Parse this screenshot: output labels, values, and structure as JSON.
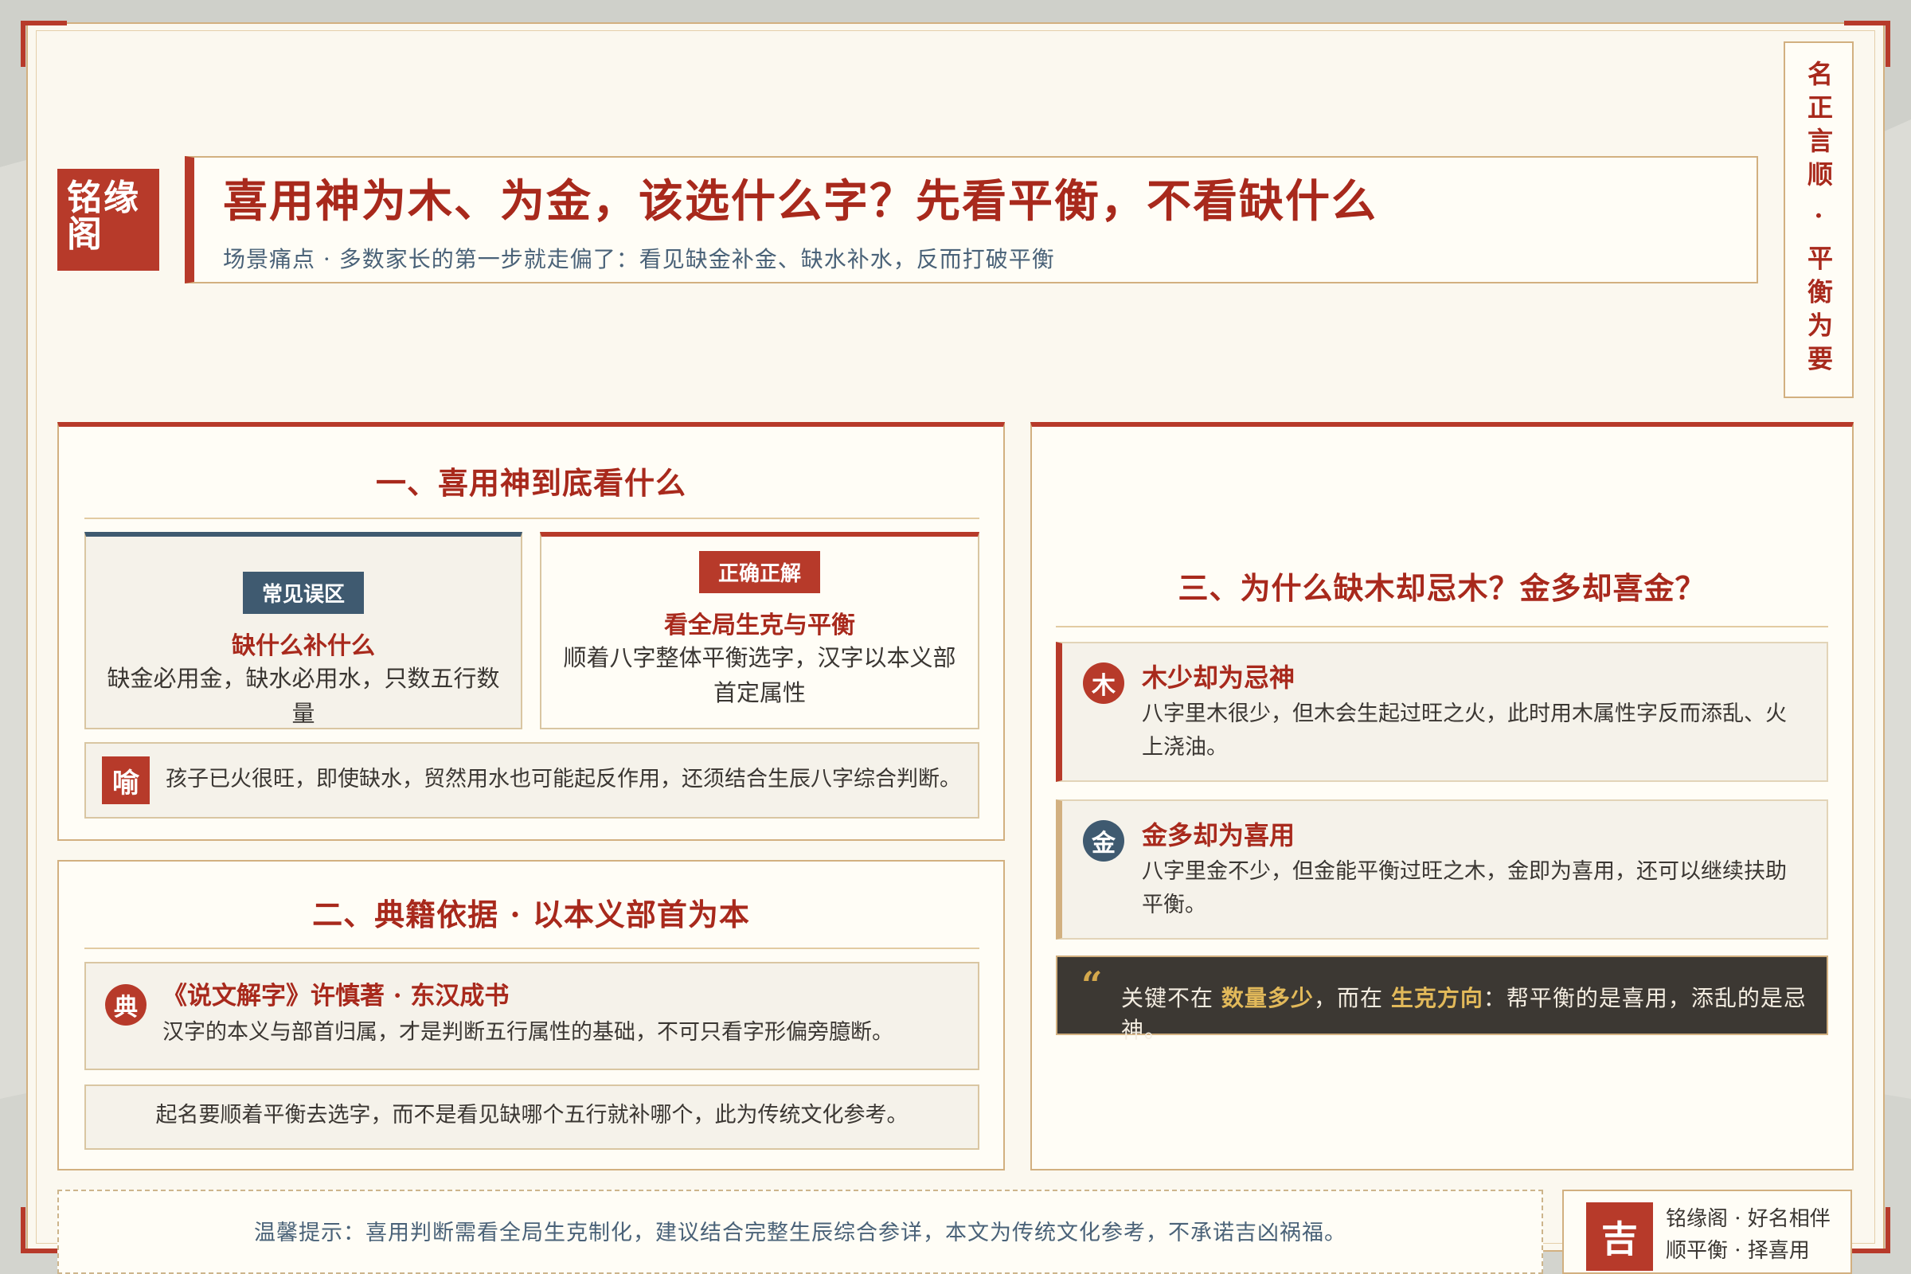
{
  "brand": {
    "logo_text": "铭缘阁"
  },
  "header": {
    "title": "喜用神为木、为金，该选什么字？先看平衡，不看缺什么",
    "subtitle": "场景痛点 · 多数家长的第一步就走偏了：看见缺金补金、缺水补水，反而打破平衡"
  },
  "side_motto": "名正言顺 · 平衡为要",
  "section1": {
    "heading": "一、喜用神到底看什么",
    "wrong": {
      "tag": "常见误区",
      "title": "缺什么补什么",
      "text": "缺金必用金，缺水必用水，只数五行数量"
    },
    "right": {
      "tag": "正确正解",
      "title": "看全局生克与平衡",
      "text": "顺着八字整体平衡选字，汉字以本义部首定属性"
    },
    "example": {
      "badge": "喻",
      "text": "孩子已火很旺，即使缺水，贸然用水也可能起反作用，还须结合生辰八字综合判断。"
    }
  },
  "section2": {
    "heading": "二、典籍依据 · 以本义部首为本",
    "classic": {
      "badge": "典",
      "title": "《说文解字》许慎著 · 东汉成书",
      "text": "汉字的本义与部首归属，才是判断五行属性的基础，不可只看字形偏旁臆断。"
    },
    "note": "起名要顺着平衡去选字，而不是看见缺哪个五行就补哪个，此为传统文化参考。"
  },
  "section3": {
    "heading": "三、为什么缺木却忌木？金多却喜金？",
    "items": [
      {
        "badge": "木",
        "title": "木少却为忌神",
        "text": "八字里木很少，但木会生起过旺之火，此时用木属性字反而添乱、火上浇油。"
      },
      {
        "badge": "金",
        "title": "金多却为喜用",
        "text": "八字里金不少，但金能平衡过旺之木，金即为喜用，还可以继续扶助平衡。"
      }
    ],
    "key": {
      "quote_mark": "“",
      "prefix": "关键不在",
      "hl1": "数量多少",
      "mid": "，而在",
      "hl2": "生克方向",
      "suffix": "：帮平衡的是喜用，添乱的是忌神。"
    }
  },
  "footer": {
    "note": "温馨提示：喜用判断需看全局生克制化，建议结合完整生辰综合参详，本文为传统文化参考，不承诺吉凶祸福。",
    "seal": "吉",
    "sign_line1": "铭缘阁 · 好名相伴",
    "sign_line2": "顺平衡 · 择喜用"
  },
  "colors": {
    "accent_red": "#b73a2a",
    "accent_blue": "#3f5a70",
    "gold": "#d2b080",
    "dark": "#3c3833"
  }
}
